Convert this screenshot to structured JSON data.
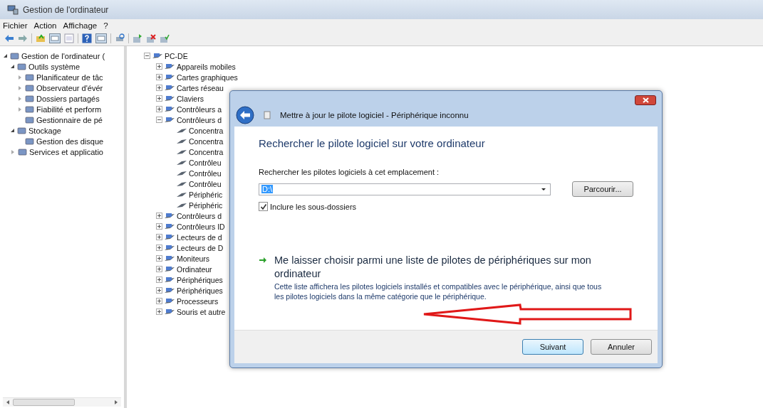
{
  "window": {
    "title": "Gestion de l'ordinateur"
  },
  "menu": [
    "Fichier",
    "Action",
    "Affichage",
    "?"
  ],
  "sidebar": {
    "items": [
      {
        "label": "Gestion de l'ordinateur (",
        "expanded": true,
        "children": [
          {
            "label": "Outils système",
            "expanded": true,
            "children": [
              {
                "label": "Planificateur de tâc",
                "expanded": false
              },
              {
                "label": "Observateur d'évér",
                "expanded": false
              },
              {
                "label": "Dossiers partagés",
                "expanded": false
              },
              {
                "label": "Fiabilité et perform",
                "expanded": false
              },
              {
                "label": "Gestionnaire de pé"
              }
            ]
          },
          {
            "label": "Stockage",
            "expanded": true,
            "children": [
              {
                "label": "Gestion des disque"
              }
            ]
          },
          {
            "label": "Services et applicatio",
            "expanded": false
          }
        ]
      }
    ]
  },
  "device_tree": {
    "label": "PC-DE",
    "expanded": true,
    "children": [
      {
        "label": "Appareils mobiles",
        "expanded": false
      },
      {
        "label": "Cartes graphiques",
        "expanded": false
      },
      {
        "label": "Cartes réseau",
        "expanded": false
      },
      {
        "label": "Claviers",
        "expanded": false
      },
      {
        "label": "Contrôleurs a",
        "expanded": false
      },
      {
        "label": "Contrôleurs d",
        "expanded": true,
        "children": [
          {
            "label": "Concentra"
          },
          {
            "label": "Concentra"
          },
          {
            "label": "Concentra"
          },
          {
            "label": "Contrôleu"
          },
          {
            "label": "Contrôleu"
          },
          {
            "label": "Contrôleu"
          },
          {
            "label": "Périphéric"
          },
          {
            "label": "Périphéric"
          }
        ]
      },
      {
        "label": "Contrôleurs d",
        "expanded": false
      },
      {
        "label": "Contrôleurs ID",
        "expanded": false
      },
      {
        "label": "Lecteurs de d",
        "expanded": false
      },
      {
        "label": "Lecteurs de D",
        "expanded": false
      },
      {
        "label": "Moniteurs",
        "expanded": false
      },
      {
        "label": "Ordinateur",
        "expanded": false
      },
      {
        "label": "Périphériques",
        "expanded": false
      },
      {
        "label": "Périphériques",
        "expanded": false
      },
      {
        "label": "Processeurs",
        "expanded": false
      },
      {
        "label": "Souris et autre",
        "expanded": false
      }
    ]
  },
  "dialog": {
    "title": "Mettre à jour le pilote logiciel - Périphérique inconnu",
    "heading": "Rechercher le pilote logiciel sur votre ordinateur",
    "location_label": "Rechercher les pilotes logiciels à cet emplacement :",
    "location_field": {
      "value": "D:\\",
      "highlighted": true
    },
    "browse_button": "Parcourir...",
    "include_subfolders": {
      "label": "Inclure les sous-dossiers",
      "checked": true
    },
    "option": {
      "title": "Me laisser choisir parmi une liste de pilotes de périphériques sur mon ordinateur",
      "description": "Cette liste affichera les pilotes logiciels installés et compatibles avec le périphérique, ainsi que tous les pilotes logiciels dans la même catégorie que le périphérique."
    },
    "buttons": [
      {
        "label": "Suivant",
        "default": true
      },
      {
        "label": "Annuler",
        "default": false
      }
    ]
  }
}
